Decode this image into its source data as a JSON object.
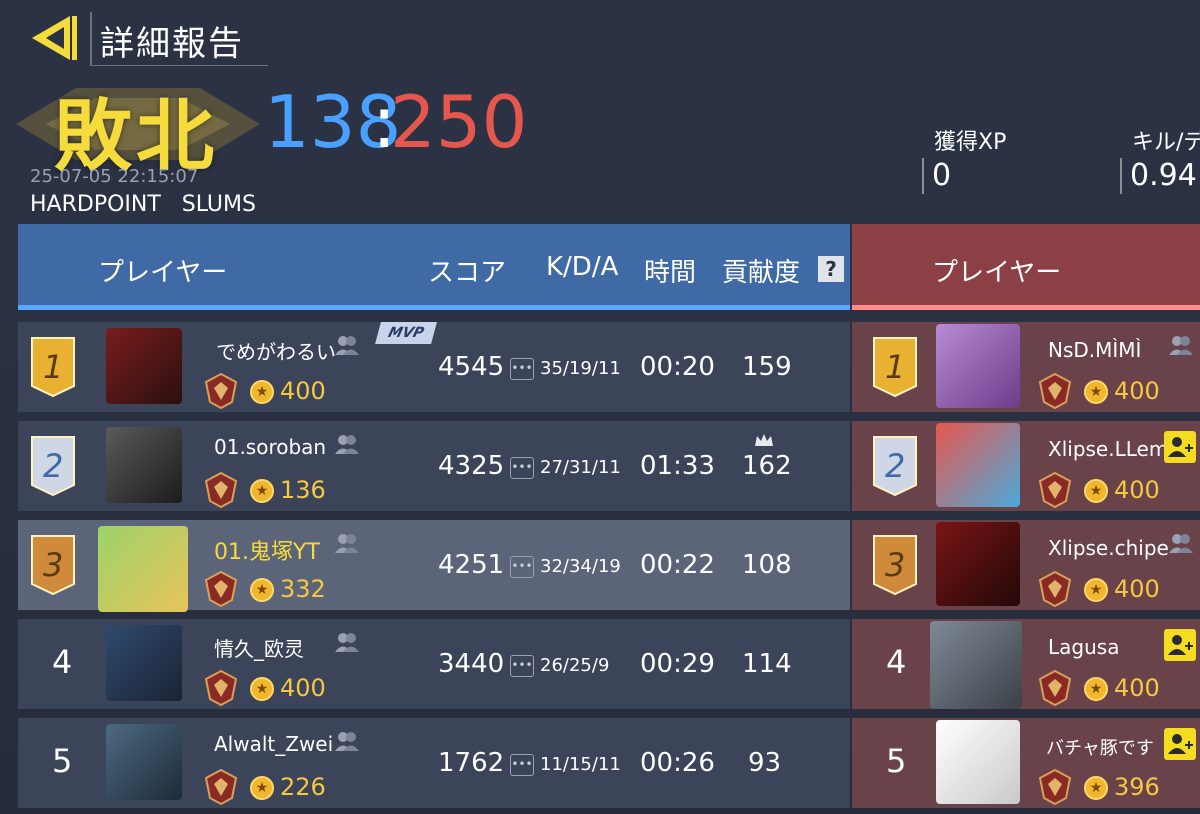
{
  "header": {
    "title": "詳細報告"
  },
  "result": {
    "label": "敗北",
    "score_blue": "138",
    "separator": ":",
    "score_red": "250",
    "datetime": "25-07-05 22:15:07",
    "mode": "HARDPOINT   SLUMS"
  },
  "stats": {
    "xp_label": "獲得XP",
    "xp_value": "0",
    "kd_label": "キル/デ",
    "kd_value": "0.94"
  },
  "columns": {
    "player": "プレイヤー",
    "score": "スコア",
    "kda": "K/D/A",
    "time": "時間",
    "contribution": "貢献度",
    "help": "?"
  },
  "mvp_label": "MVP",
  "kda_icon": "•••",
  "coin_glyph": "★",
  "blue_team": [
    {
      "rank": "1",
      "name": "でめがわるい",
      "points": "400",
      "score": "4545",
      "kda": "35/19/11",
      "time": "00:20",
      "contribution": "159"
    },
    {
      "rank": "2",
      "name": "01.soroban",
      "points": "136",
      "score": "4325",
      "kda": "27/31/11",
      "time": "01:33",
      "contribution": "162"
    },
    {
      "rank": "3",
      "name": "01.鬼塚YT",
      "points": "332",
      "score": "4251",
      "kda": "32/34/19",
      "time": "00:22",
      "contribution": "108"
    },
    {
      "rank": "4",
      "name": "情久_欧灵",
      "points": "400",
      "score": "3440",
      "kda": "26/25/9",
      "time": "00:29",
      "contribution": "114"
    },
    {
      "rank": "5",
      "name": "Alwalt_Zwei",
      "points": "226",
      "score": "1762",
      "kda": "11/15/11",
      "time": "00:26",
      "contribution": "93"
    }
  ],
  "red_team": [
    {
      "rank": "1",
      "name": "NsD.MÌMÌ",
      "points": "400"
    },
    {
      "rank": "2",
      "name": "Xlipse.LLem",
      "points": "400"
    },
    {
      "rank": "3",
      "name": "Xlipse.chipe",
      "points": "400"
    },
    {
      "rank": "4",
      "name": "Lagusa",
      "points": "400"
    },
    {
      "rank": "5",
      "name": "バチャ豚です",
      "points": "396"
    }
  ],
  "colors": {
    "blue": "#4aa0ff",
    "red": "#e5564d",
    "gold": "#f5dc3c"
  }
}
